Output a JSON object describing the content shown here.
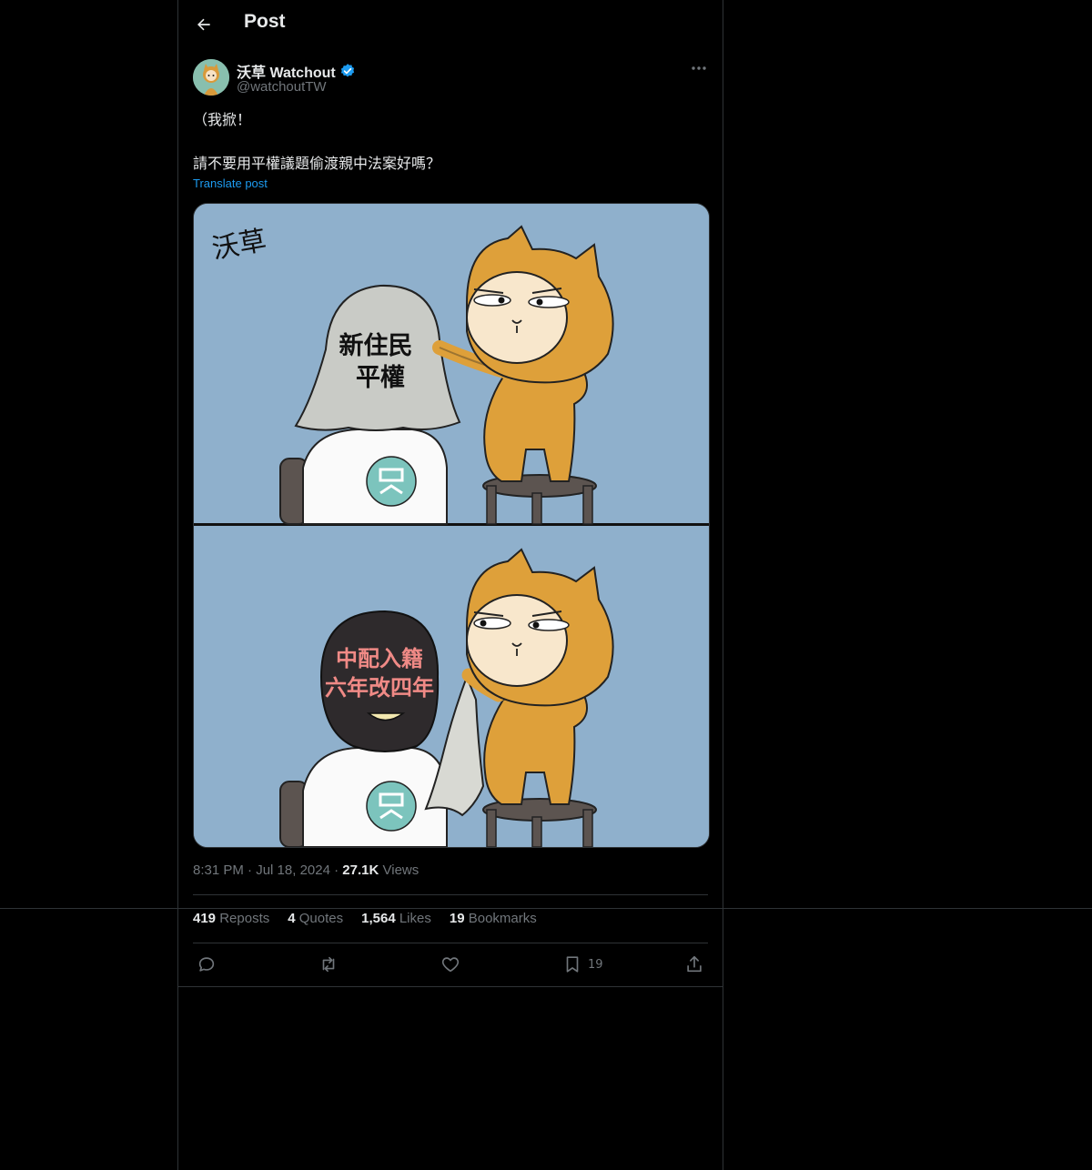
{
  "header": {
    "title": "Post",
    "back_icon": "arrow-left-icon"
  },
  "author": {
    "name": "沃草 Watchout",
    "handle": "@watchoutTW",
    "verified": true,
    "verified_color": "#1d9bf0"
  },
  "post": {
    "lines": [
      "（我掀！",
      "",
      "請不要用平權議題偷渡親中法案好嗎？"
    ],
    "translate_label": "Translate post"
  },
  "media": {
    "watermark": "沃草",
    "panel1_sign": [
      "新住民",
      "平權"
    ],
    "panel2_sign": [
      "中配入籍",
      "六年改四年"
    ]
  },
  "meta": {
    "time": "8:31 PM",
    "date": "Jul 18, 2024",
    "views_count": "27.1K",
    "views_label": "Views"
  },
  "stats": [
    {
      "count": "419",
      "label": "Reposts"
    },
    {
      "count": "4",
      "label": "Quotes"
    },
    {
      "count": "1,564",
      "label": "Likes"
    },
    {
      "count": "19",
      "label": "Bookmarks"
    }
  ],
  "actions": {
    "reply_icon": "reply-icon",
    "repost_icon": "repost-icon",
    "like_icon": "heart-icon",
    "bookmark_icon": "bookmark-icon",
    "bookmark_count": "19",
    "share_icon": "share-icon"
  },
  "colors": {
    "background": "#000000",
    "text": "#e7e9ea",
    "secondary": "#71767b",
    "link": "#1d9bf0",
    "border": "#2f3336",
    "comic_bg": "#8fb0cc",
    "cat_orange": "#dea03a"
  }
}
